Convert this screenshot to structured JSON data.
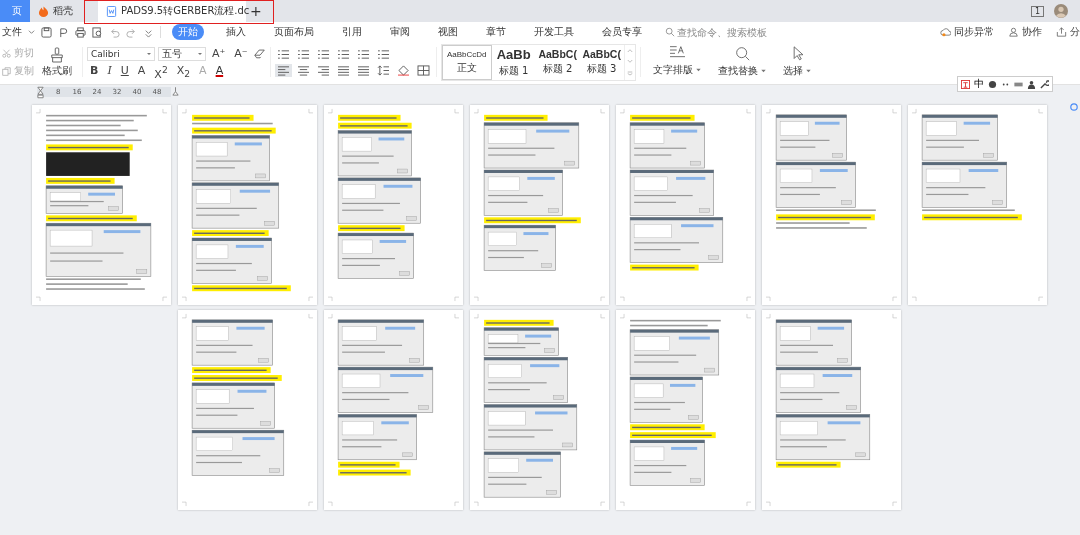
{
  "title_bar": {
    "tabs": [
      {
        "label": "页",
        "kind": "home",
        "selected": false
      },
      {
        "label": "稻壳",
        "kind": "docer",
        "selected": false
      },
      {
        "label": "PADS9.5转GERBER流程.dc",
        "kind": "doc",
        "selected": true
      }
    ],
    "new_tab": "+",
    "window_count": "1"
  },
  "menu": {
    "file": "文件",
    "tabs": [
      {
        "label": "开始",
        "selected": true
      },
      {
        "label": "插入",
        "selected": false
      },
      {
        "label": "页面布局",
        "selected": false
      },
      {
        "label": "引用",
        "selected": false
      },
      {
        "label": "审阅",
        "selected": false
      },
      {
        "label": "视图",
        "selected": false
      },
      {
        "label": "章节",
        "selected": false
      },
      {
        "label": "开发工具",
        "selected": false
      },
      {
        "label": "会员专享",
        "selected": false
      }
    ],
    "search": {
      "placeholder": "查找命令、搜索模板"
    },
    "actions": [
      {
        "label": "同步异常",
        "kind": "sync"
      },
      {
        "label": "协作",
        "kind": "collab"
      },
      {
        "label": "分",
        "kind": "share"
      }
    ]
  },
  "ribbon": {
    "clipboard": [
      {
        "label": "剪切",
        "disabled": true
      },
      {
        "label": "复制",
        "disabled": true
      }
    ],
    "format_painter": "格式刷",
    "font": "Calibri",
    "size": "五号",
    "font_tools": [
      "A⁺",
      "A⁻"
    ],
    "format_buttons": [
      "B",
      "I",
      "U",
      "A",
      "X$^{2}$",
      "X$_{2}$",
      "A",
      "A"
    ],
    "styles": [
      {
        "preview": "AaBbCcDd",
        "name": "正文",
        "kind": "body",
        "selected": true
      },
      {
        "preview": "AaBb",
        "name": "标题 1",
        "kind": "h1",
        "selected": false
      },
      {
        "preview": "AaBbC(",
        "name": "标题 2",
        "kind": "h2",
        "selected": false
      },
      {
        "preview": "AaBbC(",
        "name": "标题 3",
        "kind": "h3",
        "selected": false
      }
    ],
    "tools": [
      {
        "label": "文字排版",
        "kind": "layout"
      },
      {
        "label": "查找替换",
        "kind": "find"
      },
      {
        "label": "选择",
        "kind": "select"
      }
    ]
  },
  "ruler": {
    "ticks": [
      "8",
      "16",
      "24",
      "32",
      "40",
      "48"
    ]
  },
  "ime_bar": {
    "label": "中"
  }
}
